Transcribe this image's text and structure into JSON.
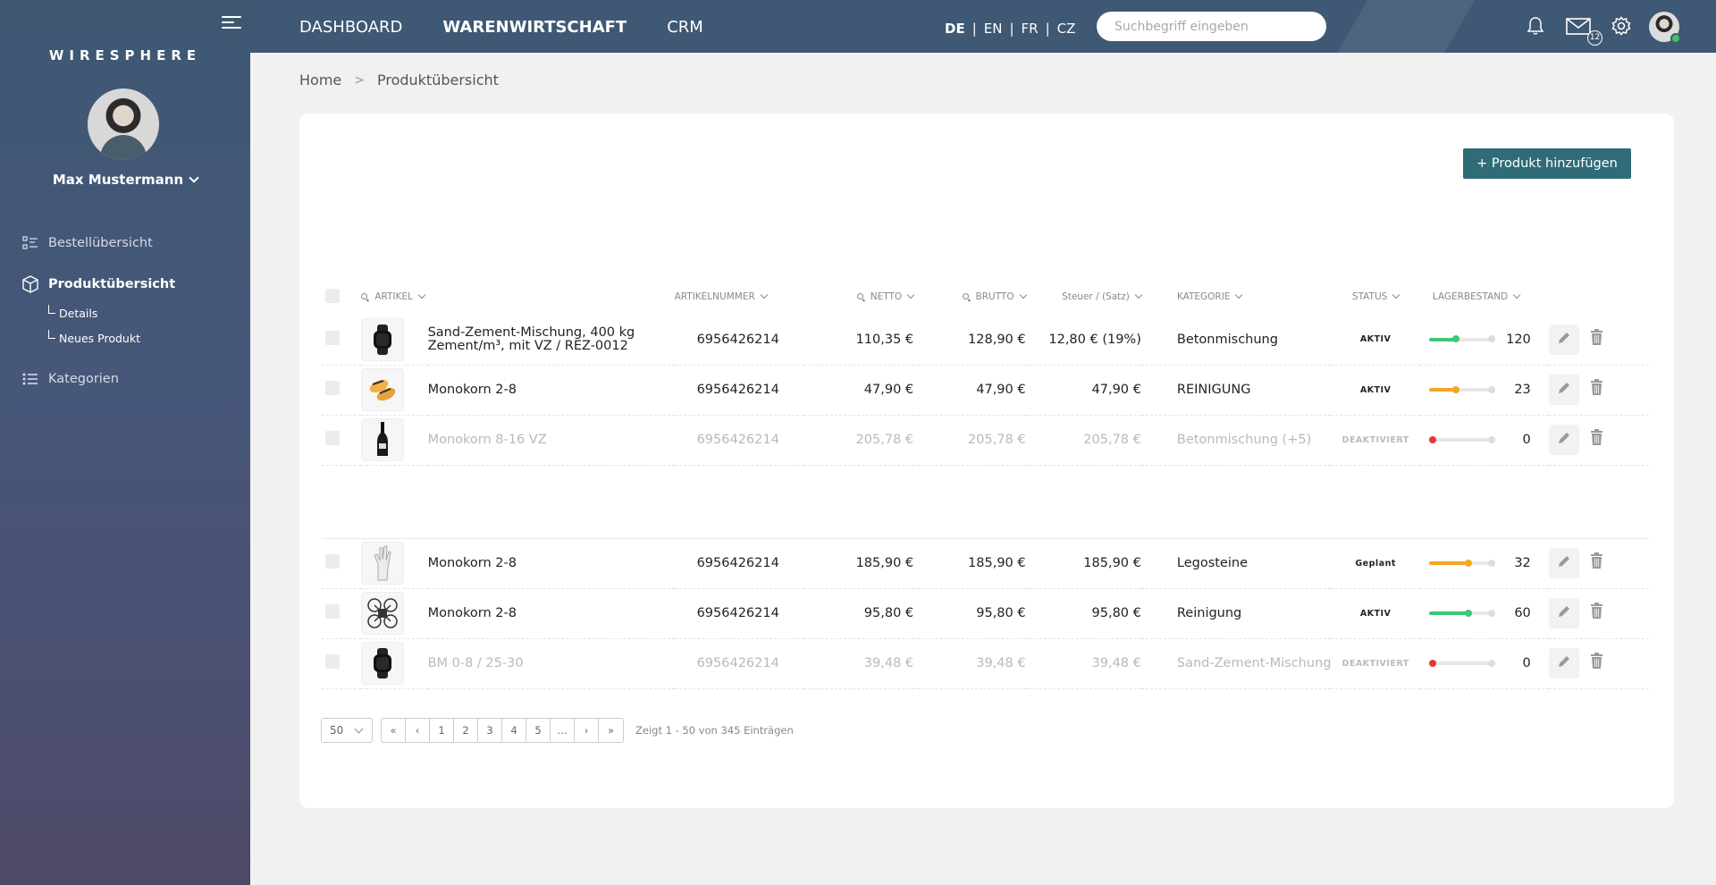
{
  "app": {
    "logo": "WIRESPHERE"
  },
  "sidebar": {
    "user_name": "Max Mustermann",
    "items": [
      {
        "label": "Bestellübersicht",
        "icon": "list-detail-icon"
      },
      {
        "label": "Produktübersicht",
        "icon": "box-icon",
        "active": true,
        "children": [
          {
            "label": "Details"
          },
          {
            "label": "Neues Produkt"
          }
        ]
      },
      {
        "label": "Kategorien",
        "icon": "list-icon"
      }
    ]
  },
  "topbar": {
    "nav": [
      "DASHBOARD",
      "WARENWIRTSCHAFT",
      "CRM"
    ],
    "active_nav": "WARENWIRTSCHAFT",
    "languages": [
      "DE",
      "EN",
      "FR",
      "CZ"
    ],
    "active_language": "DE",
    "search_placeholder": "Suchbegriff eingeben",
    "mail_badge": "12"
  },
  "breadcrumb": [
    "Home",
    "Produktübersicht"
  ],
  "main": {
    "add_button": "+ Produkt hinzufügen",
    "columns": {
      "artikel": "ARTIKEL",
      "artikelnummer": "ARTIKELNUMMER",
      "netto": "NETTO",
      "brutto": "BRUTTO",
      "steuer": "Steuer / (Satz)",
      "kategorie": "KATEGORIE",
      "status": "STATUS",
      "lagerbestand": "LAGERBESTAND"
    },
    "rows": [
      {
        "name": "Sand-Zement-Mischung, 400 kg Zement/m³, mit VZ / REZ-0012",
        "sku": "6956426214",
        "netto": "110,35 €",
        "brutto": "128,90 €",
        "steuer": "12,80 € (19%)",
        "kategorie": "Betonmischung",
        "status": "AKTIV",
        "stock": "120",
        "stock_level": 0.42,
        "stock_color": "#3cc77a",
        "faded": false,
        "thumb": "watch"
      },
      {
        "name": "Monokorn 2-8",
        "sku": "6956426214",
        "netto": "47,90 €",
        "brutto": "47,90 €",
        "steuer": "47,90 €",
        "kategorie": "REINIGUNG",
        "status": "AKTIV",
        "stock": "23",
        "stock_level": 0.42,
        "stock_color": "#f5a623",
        "faded": false,
        "thumb": "shoes"
      },
      {
        "name": "Monokorn 8-16 VZ",
        "sku": "6956426214",
        "netto": "205,78 €",
        "brutto": "205,78 €",
        "steuer": "205,78 €",
        "kategorie": "Betonmischung (+5)",
        "status": "DEAKTIVIERT",
        "stock": "0",
        "stock_level": 0,
        "stock_color": "#e33",
        "faded": true,
        "thumb": "bottle"
      },
      {
        "name": "Monokorn 2-8",
        "sku": "6956426214",
        "netto": "185,90 €",
        "brutto": "185,90 €",
        "steuer": "185,90 €",
        "kategorie": "Legosteine",
        "status": "Geplant",
        "stock": "32",
        "stock_level": 0.62,
        "stock_color": "#f5a623",
        "faded": false,
        "thumb": "hand"
      },
      {
        "name": "Monokorn 2-8",
        "sku": "6956426214",
        "netto": "95,80 €",
        "brutto": "95,80 €",
        "steuer": "95,80 €",
        "kategorie": "Reinigung",
        "status": "AKTIV",
        "stock": "60",
        "stock_level": 0.62,
        "stock_color": "#3cc77a",
        "faded": false,
        "thumb": "drone"
      },
      {
        "name": "BM 0-8 / 25-30",
        "sku": "6956426214",
        "netto": "39,48 €",
        "brutto": "39,48 €",
        "steuer": "39,48 €",
        "kategorie": "Sand-Zement-Mischung",
        "status": "DEAKTIVIERT",
        "stock": "0",
        "stock_level": 0,
        "stock_color": "#e33",
        "faded": true,
        "thumb": "watch"
      }
    ],
    "pagination": {
      "page_size": "50",
      "pages": [
        "«",
        "‹",
        "1",
        "2",
        "3",
        "4",
        "5",
        "...",
        "›",
        "»"
      ],
      "info": "Zeigt 1 - 50 von 345 Einträgen"
    }
  }
}
